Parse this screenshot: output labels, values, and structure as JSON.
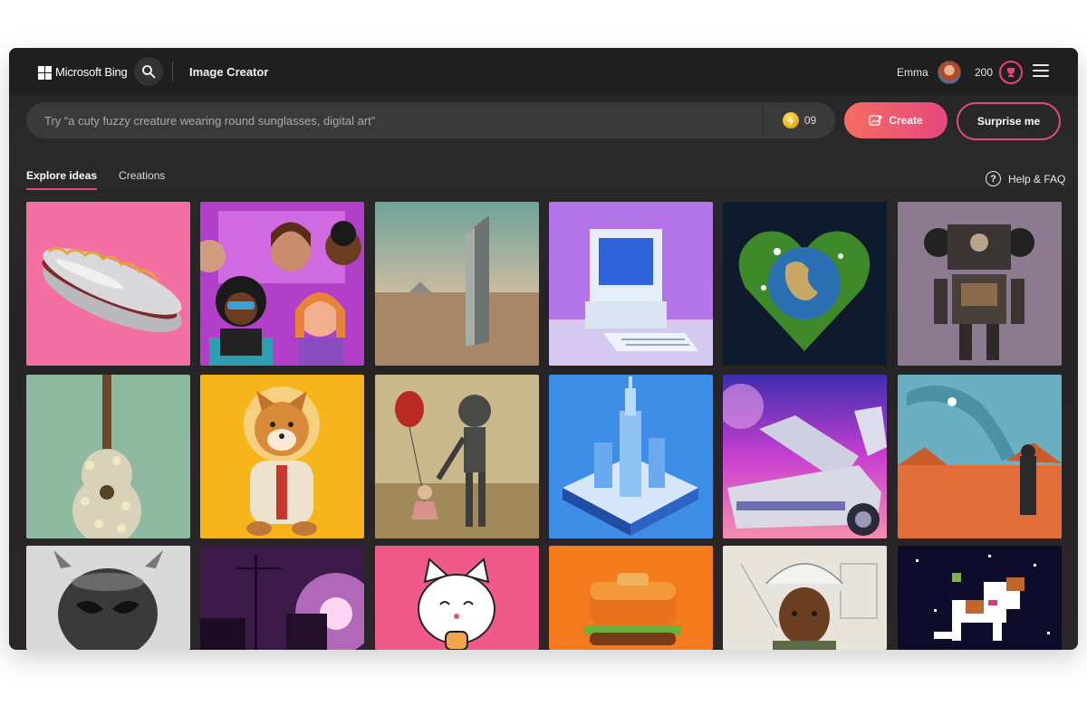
{
  "header": {
    "brand": "Microsoft Bing",
    "app_title": "Image Creator",
    "user_name": "Emma",
    "points": "200"
  },
  "prompt": {
    "placeholder": "Try “a cuty fuzzy creature wearing round sunglasses, digital art”",
    "boosts": "09"
  },
  "actions": {
    "create_label": "Create",
    "surprise_label": "Surprise me"
  },
  "tabs": [
    {
      "label": "Explore ideas",
      "active": true
    },
    {
      "label": "Creations",
      "active": false
    }
  ],
  "help_label": "Help & FAQ",
  "colors": {
    "accent": "#e04a7d",
    "create_gradient_start": "#f56d63",
    "create_gradient_end": "#e6477e",
    "background": "#242424"
  },
  "gallery": [
    {
      "subject": "chrome hot dog",
      "icon": "hotdog-image"
    },
    {
      "subject": "group of illustrated women",
      "icon": "people-image"
    },
    {
      "subject": "monolith in desert",
      "icon": "monolith-image"
    },
    {
      "subject": "retro computer",
      "icon": "computer-image"
    },
    {
      "subject": "heart-shaped earth",
      "icon": "earth-image"
    },
    {
      "subject": "retro robot",
      "icon": "robot-image"
    },
    {
      "subject": "flower guitar",
      "icon": "guitar-image"
    },
    {
      "subject": "shiba astronaut",
      "icon": "dog-image"
    },
    {
      "subject": "girl and robot with balloon",
      "icon": "balloon-image"
    },
    {
      "subject": "isometric city",
      "icon": "city-image"
    },
    {
      "subject": "synthwave car",
      "icon": "car-image"
    },
    {
      "subject": "surreal desert figure",
      "icon": "desert-image"
    },
    {
      "subject": "chrome mask",
      "icon": "mask-image"
    },
    {
      "subject": "neon street",
      "icon": "street-image"
    },
    {
      "subject": "cartoon cat",
      "icon": "cat-image"
    },
    {
      "subject": "burger",
      "icon": "burger-image"
    },
    {
      "subject": "portrait with hard hat",
      "icon": "portrait-image"
    },
    {
      "subject": "pixel dog in space",
      "icon": "pixel-dog-image"
    }
  ]
}
